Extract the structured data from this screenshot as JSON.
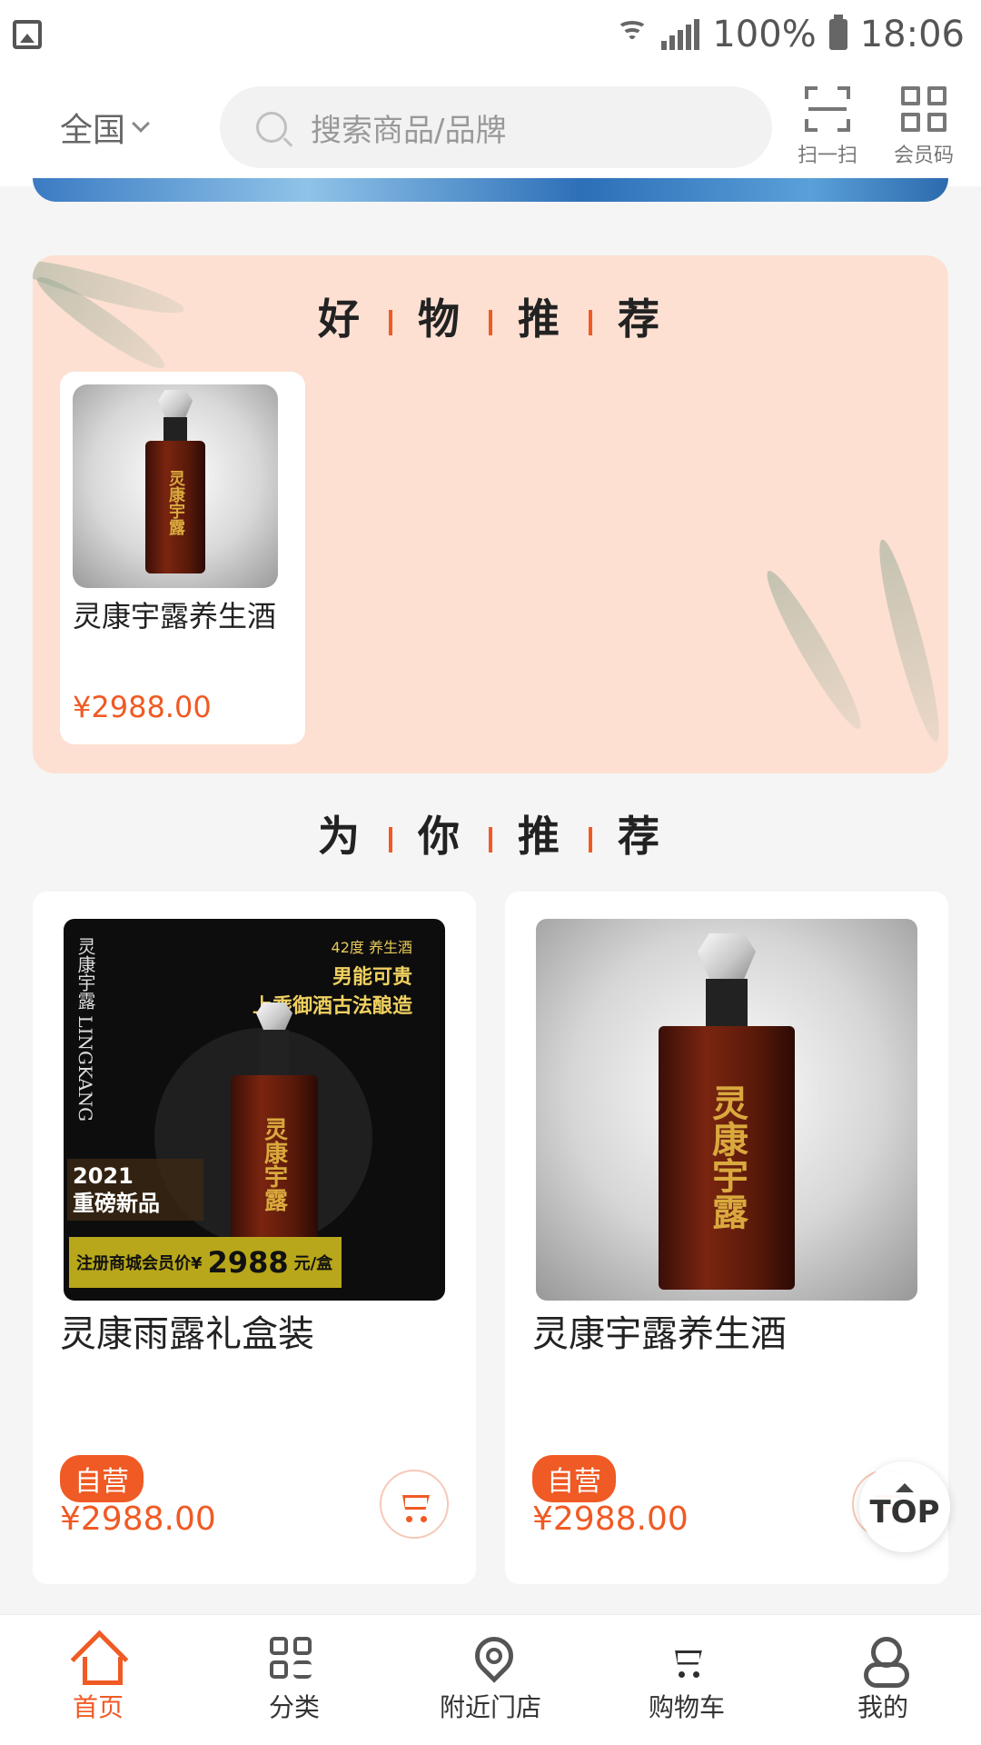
{
  "status_bar": {
    "battery": "100%",
    "time": "18:06"
  },
  "header": {
    "region": "全国",
    "search_placeholder": "搜索商品/品牌",
    "scan_label": "扫一扫",
    "member_code_label": "会员码"
  },
  "good_section": {
    "title_chars": [
      "好",
      "物",
      "推",
      "荐"
    ],
    "product": {
      "name": "灵康宇露养生酒",
      "price": "¥2988.00"
    }
  },
  "for_you_section": {
    "title_chars": [
      "为",
      "你",
      "推",
      "荐"
    ],
    "products": [
      {
        "name": "灵康雨露礼盒装",
        "badge": "自营",
        "price": "¥2988.00",
        "image_text": {
          "brand": "灵康宇露",
          "brand_en": "LINGKANG",
          "tag1": "42度 养生酒",
          "tag2": "男能可贵",
          "tag3": "上乘御酒古法酿造",
          "year": "2021",
          "new": "重磅新品",
          "member_prefix": "注册商城会员价¥",
          "member_price": "2988",
          "member_suffix": "元/盒"
        }
      },
      {
        "name": "灵康宇露养生酒",
        "badge": "自营",
        "price": "¥2988.00"
      }
    ]
  },
  "bottle_label": "灵康宇露",
  "top_button": "TOP",
  "bottom_nav": [
    {
      "label": "首页",
      "icon": "home-icon",
      "active": true
    },
    {
      "label": "分类",
      "icon": "category-icon",
      "active": false
    },
    {
      "label": "附近门店",
      "icon": "location-icon",
      "active": false
    },
    {
      "label": "购物车",
      "icon": "cart-icon",
      "active": false
    },
    {
      "label": "我的",
      "icon": "user-icon",
      "active": false
    }
  ],
  "colors": {
    "accent": "#f05a24",
    "section_bg": "#fde0d2"
  }
}
